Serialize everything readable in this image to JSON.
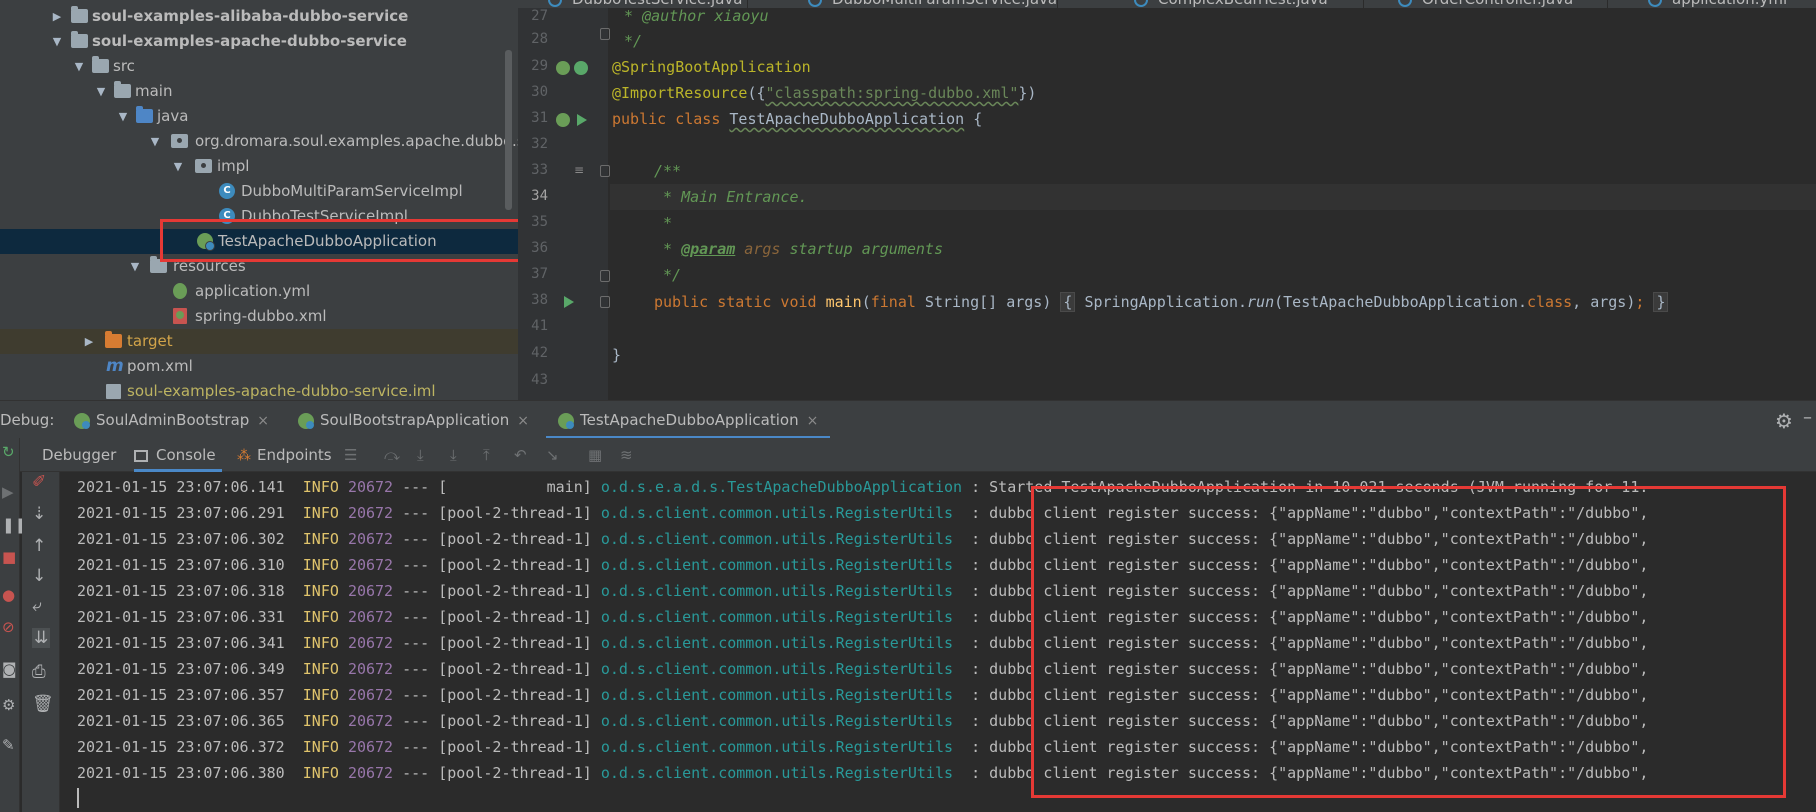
{
  "project_tree": {
    "items": [
      {
        "label": "soul-examples-alibaba-dubbo-service",
        "bold": true
      },
      {
        "label": "soul-examples-apache-dubbo-service",
        "bold": true
      },
      {
        "label": "src"
      },
      {
        "label": "main"
      },
      {
        "label": "java"
      },
      {
        "label": "org.dromara.soul.examples.apache.dubbo.se"
      },
      {
        "label": "impl"
      },
      {
        "label": "DubboMultiParamServiceImpl"
      },
      {
        "label": "DubboTestServiceImpl"
      },
      {
        "label": "TestApacheDubboApplication"
      },
      {
        "label": "resources"
      },
      {
        "label": "application.yml"
      },
      {
        "label": "spring-dubbo.xml"
      },
      {
        "label": "target"
      },
      {
        "label": "pom.xml"
      },
      {
        "label": "soul-examples-apache-dubbo-service.iml"
      }
    ]
  },
  "editor": {
    "tabs": [
      "DubboTestService.java",
      "DubboMultiParamService.java",
      "ComplexBeanTest.java",
      "OrderController.java",
      "application.yml"
    ],
    "line_numbers": [
      "27",
      "28",
      "29",
      "30",
      "31",
      "32",
      "33",
      "34",
      "35",
      "36",
      "37",
      "38",
      "41",
      "42",
      "43"
    ],
    "code": {
      "l27": " * @author xiaoyu",
      "l28": " */",
      "l29": "@SpringBootApplication",
      "l30_a": "@ImportResource",
      "l30_b": "({",
      "l30_c": "\"classpath:spring-dubbo.xml\"",
      "l30_d": "})",
      "l31_kw": "public class",
      "l31_name": "TestApacheDubboApplication",
      "l31_rest": " {",
      "l33": "/**",
      "l34": " * Main Entrance.",
      "l35": " *",
      "l36_a": " * ",
      "l36_tag": "@param",
      "l36_arg": " args",
      "l36_rest": " startup arguments",
      "l37": " */",
      "l38_kw": "public static void",
      "l38_fn": " main",
      "l38_a": "(",
      "l38_final": "final",
      "l38_b": " String[] args) ",
      "l38_fold_open": "{",
      "l38_c": " SpringApplication.",
      "l38_run": "run",
      "l38_d": "(TestApacheDubboApplication.",
      "l38_class": "class",
      "l38_e": ", args)",
      "l38_semi": ";",
      "l38_fold_close": "}",
      "l42": "}"
    }
  },
  "debug": {
    "label": "Debug:",
    "run_tabs": [
      {
        "label": "SoulAdminBootstrap"
      },
      {
        "label": "SoulBootstrapApplication"
      },
      {
        "label": "TestApacheDubboApplication"
      }
    ],
    "close_glyph": "×",
    "sub_tabs": {
      "debugger": "Debugger",
      "console": "Console",
      "endpoints": "Endpoints"
    }
  },
  "console": {
    "lines": [
      {
        "ts": "2021-01-15 23:07:06.141",
        "lvl": "INFO",
        "pid": "20672",
        "sep": " --- ",
        "thread": "[           main]",
        "logger": "o.d.s.e.a.d.s.TestApacheDubboApplication",
        "msg": " : Started TestApacheDubboApplication in 10.021 seconds (JVM running for 11."
      },
      {
        "ts": "2021-01-15 23:07:06.291",
        "lvl": "INFO",
        "pid": "20672",
        "sep": " --- ",
        "thread": "[pool-2-thread-1]",
        "logger": "o.d.s.client.common.utils.RegisterUtils ",
        "msg": " : dubbo client register success: {\"appName\":\"dubbo\",\"contextPath\":\"/dubbo\","
      },
      {
        "ts": "2021-01-15 23:07:06.302",
        "lvl": "INFO",
        "pid": "20672",
        "sep": " --- ",
        "thread": "[pool-2-thread-1]",
        "logger": "o.d.s.client.common.utils.RegisterUtils ",
        "msg": " : dubbo client register success: {\"appName\":\"dubbo\",\"contextPath\":\"/dubbo\","
      },
      {
        "ts": "2021-01-15 23:07:06.310",
        "lvl": "INFO",
        "pid": "20672",
        "sep": " --- ",
        "thread": "[pool-2-thread-1]",
        "logger": "o.d.s.client.common.utils.RegisterUtils ",
        "msg": " : dubbo client register success: {\"appName\":\"dubbo\",\"contextPath\":\"/dubbo\","
      },
      {
        "ts": "2021-01-15 23:07:06.318",
        "lvl": "INFO",
        "pid": "20672",
        "sep": " --- ",
        "thread": "[pool-2-thread-1]",
        "logger": "o.d.s.client.common.utils.RegisterUtils ",
        "msg": " : dubbo client register success: {\"appName\":\"dubbo\",\"contextPath\":\"/dubbo\","
      },
      {
        "ts": "2021-01-15 23:07:06.331",
        "lvl": "INFO",
        "pid": "20672",
        "sep": " --- ",
        "thread": "[pool-2-thread-1]",
        "logger": "o.d.s.client.common.utils.RegisterUtils ",
        "msg": " : dubbo client register success: {\"appName\":\"dubbo\",\"contextPath\":\"/dubbo\","
      },
      {
        "ts": "2021-01-15 23:07:06.341",
        "lvl": "INFO",
        "pid": "20672",
        "sep": " --- ",
        "thread": "[pool-2-thread-1]",
        "logger": "o.d.s.client.common.utils.RegisterUtils ",
        "msg": " : dubbo client register success: {\"appName\":\"dubbo\",\"contextPath\":\"/dubbo\","
      },
      {
        "ts": "2021-01-15 23:07:06.349",
        "lvl": "INFO",
        "pid": "20672",
        "sep": " --- ",
        "thread": "[pool-2-thread-1]",
        "logger": "o.d.s.client.common.utils.RegisterUtils ",
        "msg": " : dubbo client register success: {\"appName\":\"dubbo\",\"contextPath\":\"/dubbo\","
      },
      {
        "ts": "2021-01-15 23:07:06.357",
        "lvl": "INFO",
        "pid": "20672",
        "sep": " --- ",
        "thread": "[pool-2-thread-1]",
        "logger": "o.d.s.client.common.utils.RegisterUtils ",
        "msg": " : dubbo client register success: {\"appName\":\"dubbo\",\"contextPath\":\"/dubbo\","
      },
      {
        "ts": "2021-01-15 23:07:06.365",
        "lvl": "INFO",
        "pid": "20672",
        "sep": " --- ",
        "thread": "[pool-2-thread-1]",
        "logger": "o.d.s.client.common.utils.RegisterUtils ",
        "msg": " : dubbo client register success: {\"appName\":\"dubbo\",\"contextPath\":\"/dubbo\","
      },
      {
        "ts": "2021-01-15 23:07:06.372",
        "lvl": "INFO",
        "pid": "20672",
        "sep": " --- ",
        "thread": "[pool-2-thread-1]",
        "logger": "o.d.s.client.common.utils.RegisterUtils ",
        "msg": " : dubbo client register success: {\"appName\":\"dubbo\",\"contextPath\":\"/dubbo\","
      },
      {
        "ts": "2021-01-15 23:07:06.380",
        "lvl": "INFO",
        "pid": "20672",
        "sep": " --- ",
        "thread": "[pool-2-thread-1]",
        "logger": "o.d.s.client.common.utils.RegisterUtils ",
        "msg": " : dubbo client register success: {\"appName\":\"dubbo\",\"contextPath\":\"/dubbo\","
      }
    ]
  },
  "icons": {
    "expanded": "▼",
    "collapsed": "▶",
    "class_letter": "C",
    "pom_letter": "m",
    "gear": "⚙",
    "hide": "–"
  },
  "colors": {
    "highlight_box": "#e53935",
    "selection": "#0d293e",
    "accent": "#4a88c7"
  }
}
